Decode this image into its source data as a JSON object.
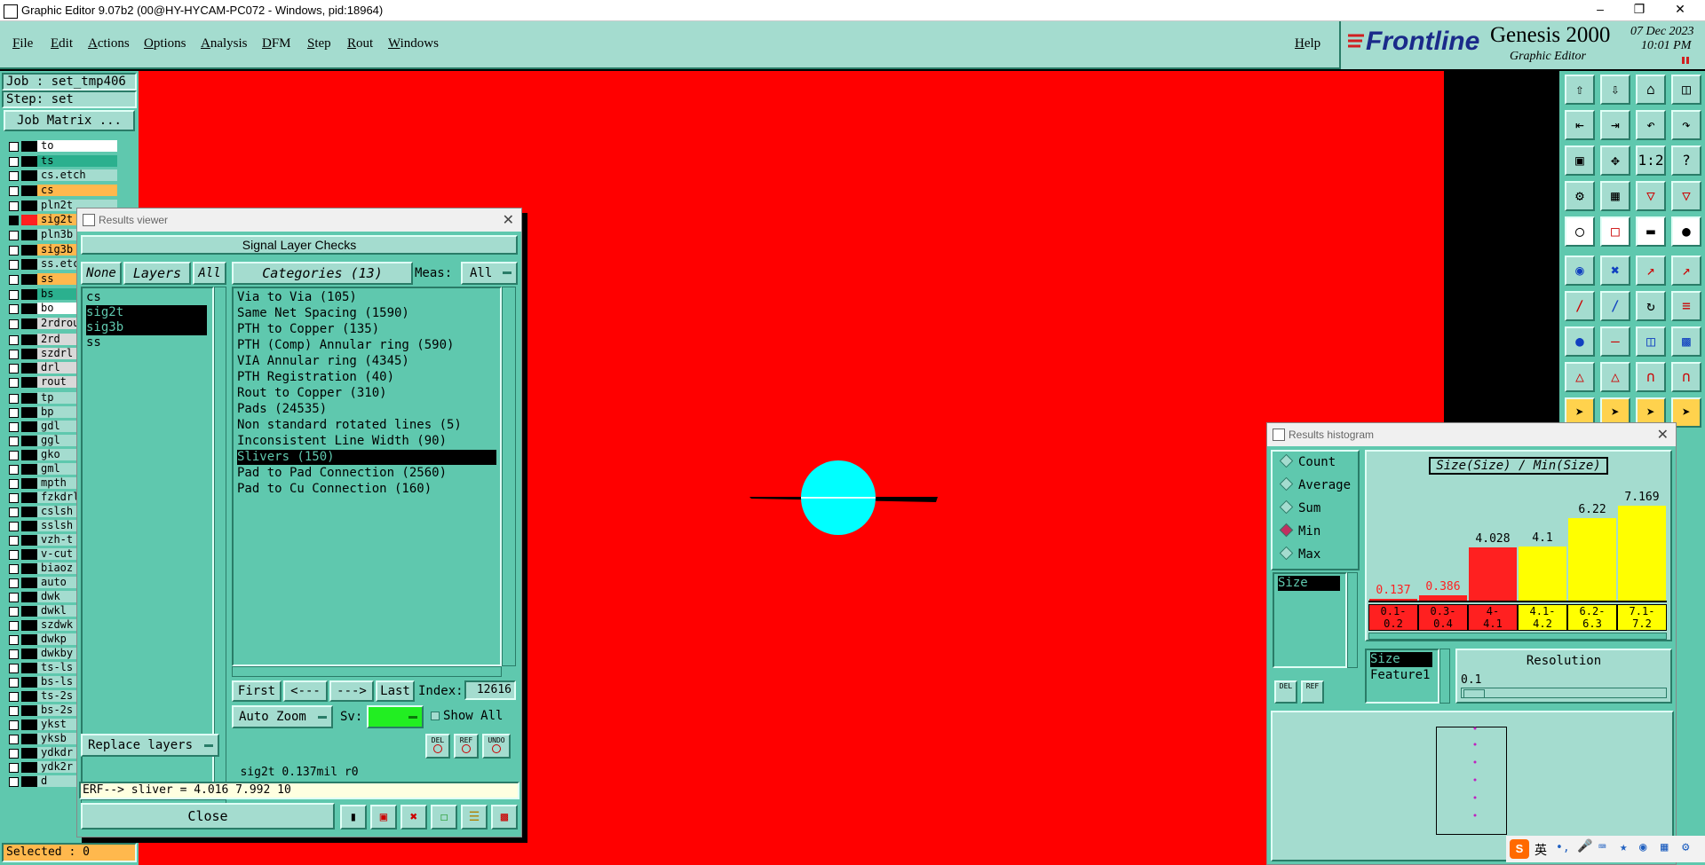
{
  "window": {
    "title": "Graphic Editor 9.07b2 (00@HY-HYCAM-PC072 - Windows, pid:18964)"
  },
  "menu": [
    "File",
    "Edit",
    "Actions",
    "Options",
    "Analysis",
    "DFM",
    "Step",
    "Rout",
    "Windows"
  ],
  "help": "Help",
  "brand": {
    "logo": "Frontline",
    "product": "Genesis 2000",
    "subtitle": "Graphic Editor",
    "date": "07 Dec 2023",
    "time": "10:01 PM"
  },
  "job": {
    "job": "Job : set_tmp406",
    "step": "Step: set",
    "matrix_button": "Job Matrix ...",
    "selected": "Selected : 0"
  },
  "layers": [
    {
      "name": "to",
      "color": "#ffffff",
      "checked": false
    },
    {
      "name": "ts",
      "color": "#2bb08e",
      "checked": false
    },
    {
      "name": "cs.etch",
      "color": "#a4dccf",
      "checked": false
    },
    {
      "name": "cs",
      "color": "#ffb84d",
      "checked": false
    },
    {
      "name": "pln2t",
      "color": "#a4dccf",
      "checked": false
    },
    {
      "name": "sig2t",
      "color": "#ffb84d",
      "checked": true
    },
    {
      "name": "pln3b",
      "color": "#a4dccf",
      "checked": false
    },
    {
      "name": "sig3b",
      "color": "#ffb84d",
      "checked": false
    },
    {
      "name": "ss.etc",
      "color": "#a4dccf",
      "checked": false
    },
    {
      "name": "ss",
      "color": "#ffb84d",
      "checked": false
    },
    {
      "name": "bs",
      "color": "#2bb08e",
      "checked": false
    },
    {
      "name": "bo",
      "color": "#ffffff",
      "checked": false
    },
    {
      "name": "2rdrou",
      "color": "#d9d9d9",
      "checked": false
    },
    {
      "name": "2rd",
      "color": "#d9d9d9",
      "checked": false
    },
    {
      "name": "szdrl",
      "color": "#d9d9d9",
      "checked": false
    },
    {
      "name": "drl",
      "color": "#d9d9d9",
      "checked": false
    },
    {
      "name": "rout",
      "color": "#d9d9d9",
      "checked": false
    },
    {
      "name": "tp",
      "color": "#a4dccf",
      "checked": false
    },
    {
      "name": "bp",
      "color": "#a4dccf",
      "checked": false
    },
    {
      "name": "gdl",
      "color": "#a4dccf",
      "checked": false
    },
    {
      "name": "ggl",
      "color": "#a4dccf",
      "checked": false
    },
    {
      "name": "gko",
      "color": "#a4dccf",
      "checked": false
    },
    {
      "name": "gml",
      "color": "#a4dccf",
      "checked": false
    },
    {
      "name": "mpth",
      "color": "#a4dccf",
      "checked": false
    },
    {
      "name": "fzkdrl",
      "color": "#a4dccf",
      "checked": false
    },
    {
      "name": "cslsh",
      "color": "#a4dccf",
      "checked": false
    },
    {
      "name": "sslsh",
      "color": "#a4dccf",
      "checked": false
    },
    {
      "name": "vzh-t",
      "color": "#a4dccf",
      "checked": false
    },
    {
      "name": "v-cut",
      "color": "#a4dccf",
      "checked": false
    },
    {
      "name": "biaoz",
      "color": "#a4dccf",
      "checked": false
    },
    {
      "name": "auto",
      "color": "#a4dccf",
      "checked": false
    },
    {
      "name": "dwk",
      "color": "#a4dccf",
      "checked": false
    },
    {
      "name": "dwkl",
      "color": "#a4dccf",
      "checked": false
    },
    {
      "name": "szdwk",
      "color": "#a4dccf",
      "checked": false
    },
    {
      "name": "dwkp",
      "color": "#a4dccf",
      "checked": false
    },
    {
      "name": "dwkby",
      "color": "#a4dccf",
      "checked": false
    },
    {
      "name": "ts-ls",
      "color": "#a4dccf",
      "checked": false
    },
    {
      "name": "bs-ls",
      "color": "#a4dccf",
      "checked": false
    },
    {
      "name": "ts-2s",
      "color": "#a4dccf",
      "checked": false
    },
    {
      "name": "bs-2s",
      "color": "#a4dccf",
      "checked": false
    },
    {
      "name": "ykst",
      "color": "#a4dccf",
      "checked": false
    },
    {
      "name": "yksb",
      "color": "#a4dccf",
      "checked": false
    },
    {
      "name": "ydkdr",
      "color": "#a4dccf",
      "checked": false
    },
    {
      "name": "ydk2r",
      "color": "#a4dccf",
      "checked": false
    },
    {
      "name": "d",
      "color": "#a4dccf",
      "checked": false
    }
  ],
  "results_viewer": {
    "title": "Results viewer",
    "header": "Signal Layer Checks",
    "none": "None",
    "layers": "Layers",
    "all": "All",
    "categories_label": "Categories (13)",
    "meas_label": "Meas:",
    "meas_value": "All",
    "layer_list": [
      {
        "name": "cs",
        "selected": false
      },
      {
        "name": "sig2t",
        "selected": true
      },
      {
        "name": "sig3b",
        "selected": true
      },
      {
        "name": "ss",
        "selected": false
      }
    ],
    "categories": [
      {
        "name": "Via to Via (105)",
        "selected": false
      },
      {
        "name": "Same Net Spacing (1590)",
        "selected": false
      },
      {
        "name": "PTH to Copper (135)",
        "selected": false
      },
      {
        "name": "PTH (Comp) Annular ring (590)",
        "selected": false
      },
      {
        "name": "VIA Annular ring (4345)",
        "selected": false
      },
      {
        "name": "PTH Registration (40)",
        "selected": false
      },
      {
        "name": "Rout to Copper (310)",
        "selected": false
      },
      {
        "name": "Pads (24535)",
        "selected": false
      },
      {
        "name": "Non standard rotated lines (5)",
        "selected": false
      },
      {
        "name": "Inconsistent Line Width (90)",
        "selected": false
      },
      {
        "name": "Slivers (150)",
        "selected": true
      },
      {
        "name": "Pad to Pad Connection (2560)",
        "selected": false
      },
      {
        "name": "Pad to Cu Connection (160)",
        "selected": false
      }
    ],
    "nav": {
      "first": "First",
      "prev": "<---",
      "next": "--->",
      "last": "Last",
      "index_label": "Index:",
      "index_value": "12616"
    },
    "auto_zoom": "Auto Zoom",
    "sv_label": "Sv:",
    "show_all": "Show All",
    "replace_layers": "Replace layers",
    "status": "sig2t 0.137mil  r0",
    "erf": "ERF--> sliver = 4.016 7.992 10",
    "close": "Close",
    "icon_del": "DEL",
    "icon_ref": "REF",
    "icon_undo": "UNDO"
  },
  "histogram": {
    "title": "Results histogram",
    "options": [
      {
        "name": "Count",
        "selected": false
      },
      {
        "name": "Average",
        "selected": false
      },
      {
        "name": "Sum",
        "selected": false
      },
      {
        "name": "Min",
        "selected": true
      },
      {
        "name": "Max",
        "selected": false
      }
    ],
    "attr_list": [
      "Size"
    ],
    "chart_title": "Size(Size) / Min(Size)",
    "ymax": 7.5,
    "bins": [
      {
        "label": "0.1-\n0.2",
        "value": 0.137,
        "value_text": "0.137",
        "color": "#ff2020",
        "text_color": "#ff2020"
      },
      {
        "label": "0.3-\n0.4",
        "value": 0.386,
        "value_text": "0.386",
        "color": "#ff2020",
        "text_color": "#ff2020"
      },
      {
        "label": "4-\n4.1",
        "value": 4.028,
        "value_text": "4.028",
        "color": "#ff2020",
        "text_color": "#000000"
      },
      {
        "label": "4.1-\n4.2",
        "value": 4.1,
        "value_text": "4.1",
        "color": "#ffff00",
        "text_color": "#000000"
      },
      {
        "label": "6.2-\n6.3",
        "value": 6.22,
        "value_text": "6.22",
        "color": "#ffff00",
        "text_color": "#000000"
      },
      {
        "label": "7.1-\n7.2",
        "value": 7.169,
        "value_text": "7.169",
        "color": "#ffff00",
        "text_color": "#000000"
      }
    ],
    "list2": [
      "Size",
      "Feature1"
    ],
    "resolution_label": "Resolution",
    "resolution_value": "0.1",
    "del": "DEL",
    "ref": "REF"
  },
  "taskbar": {
    "ime": "英"
  }
}
